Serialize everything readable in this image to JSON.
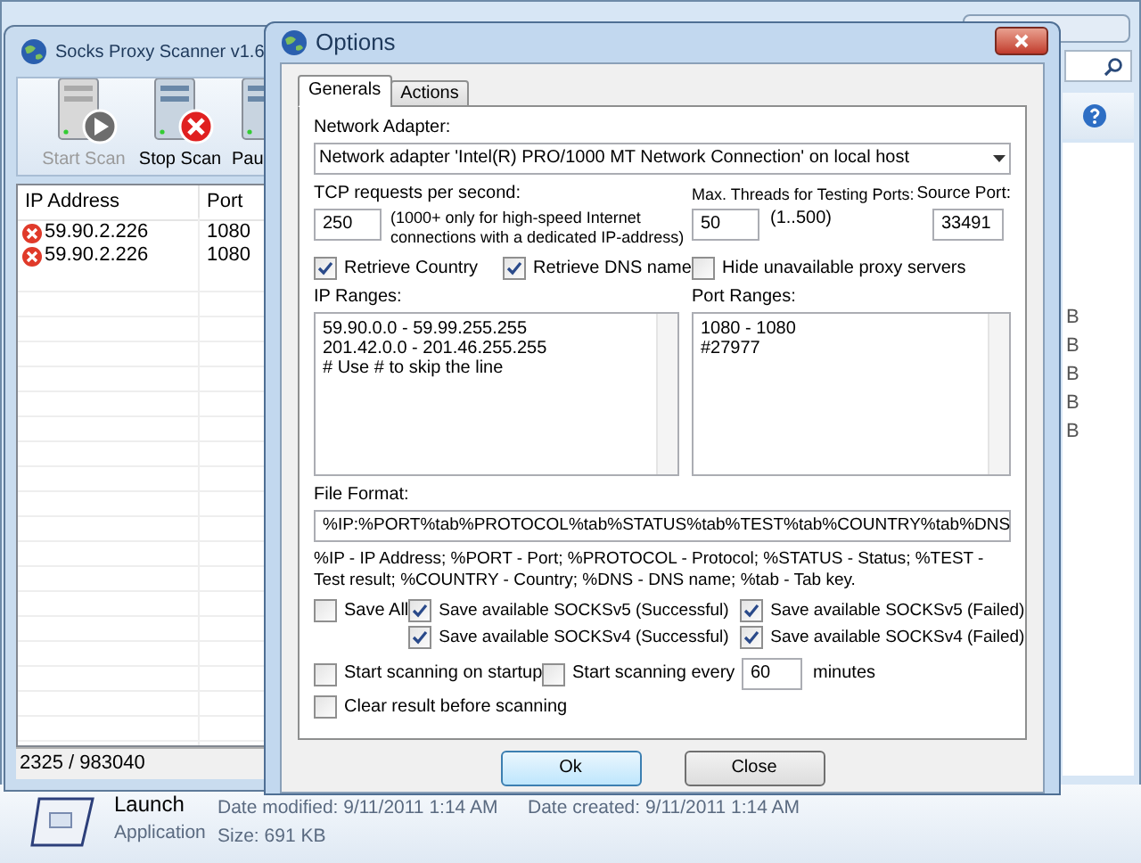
{
  "explorer": {
    "size_fragments": [
      "B",
      "B",
      "B",
      "B",
      "B"
    ],
    "details": {
      "name": "Launch",
      "type": "Application",
      "date_modified": "Date modified: 9/11/2011 1:14 AM",
      "date_created": "Date created: 9/11/2011 1:14 AM",
      "size": "Size: 691 KB"
    }
  },
  "scanner": {
    "title": "Socks Proxy Scanner v1.6",
    "toolbar": [
      {
        "label": "Start Scan",
        "kind": "start",
        "disabled": true
      },
      {
        "label": "Stop Scan",
        "kind": "stop",
        "disabled": false
      },
      {
        "label": "Pau",
        "kind": "pause",
        "disabled": false
      }
    ],
    "table": {
      "columns": [
        "IP Address",
        "Port"
      ],
      "rows": [
        {
          "ip": "59.90.2.226",
          "port": "1080"
        },
        {
          "ip": "59.90.2.226",
          "port": "1080"
        }
      ]
    },
    "status_bar": "2325 / 983040"
  },
  "options": {
    "title": "Options",
    "tabs": [
      {
        "label": "Generals",
        "selected": true
      },
      {
        "label": "Actions",
        "selected": false
      }
    ],
    "network_adapter": {
      "label": "Network Adapter:",
      "value": "Network adapter 'Intel(R) PRO/1000 MT Network Connection' on local host"
    },
    "tcp_requests": {
      "label": "TCP requests per second:",
      "value": "250",
      "note": "(1000+ only for high-speed Internet connections with a dedicated IP-address)"
    },
    "max_threads": {
      "label": "Max. Threads for Testing Ports:",
      "value": "50",
      "note": "(1..500)"
    },
    "source_port": {
      "label": "Source Port:",
      "value": "33491"
    },
    "retrieve": [
      {
        "label": "Retrieve Country",
        "checked": true
      },
      {
        "label": "Retrieve DNS name",
        "checked": true
      },
      {
        "label": "Hide unavailable proxy servers",
        "checked": false
      }
    ],
    "ip_ranges": {
      "label": "IP Ranges:",
      "lines": [
        "59.90.0.0 - 59.99.255.255",
        "201.42.0.0 - 201.46.255.255",
        "# Use # to skip the line"
      ]
    },
    "port_ranges": {
      "label": "Port Ranges:",
      "lines": [
        "1080 - 1080",
        "#27977"
      ]
    },
    "file_format": {
      "label": "File Format:",
      "value": "%IP:%PORT%tab%PROTOCOL%tab%STATUS%tab%TEST%tab%COUNTRY%tab%DNS",
      "help": "%IP - IP Address; %PORT - Port; %PROTOCOL - Protocol; %STATUS - Status; %TEST - Test result; %COUNTRY - Country; %DNS - DNS name; %tab - Tab key."
    },
    "save_all": {
      "label": "Save All",
      "checked": false
    },
    "save_options": [
      {
        "label": "Save available SOCKSv5 (Successful)",
        "checked": true
      },
      {
        "label": "Save available SOCKSv5 (Failed)",
        "checked": true
      },
      {
        "label": "Save available SOCKSv4 (Successful)",
        "checked": true
      },
      {
        "label": "Save available SOCKSv4 (Failed)",
        "checked": true
      }
    ],
    "start_on_startup": {
      "label": "Start scanning on startup",
      "checked": false
    },
    "start_every": {
      "label": "Start scanning every",
      "checked": false,
      "value": "60",
      "unit": "minutes"
    },
    "clear_result": {
      "label": "Clear result before scanning",
      "checked": false
    },
    "buttons": [
      {
        "label": "Ok",
        "kind": "default"
      },
      {
        "label": "Close",
        "kind": "normal"
      }
    ]
  }
}
